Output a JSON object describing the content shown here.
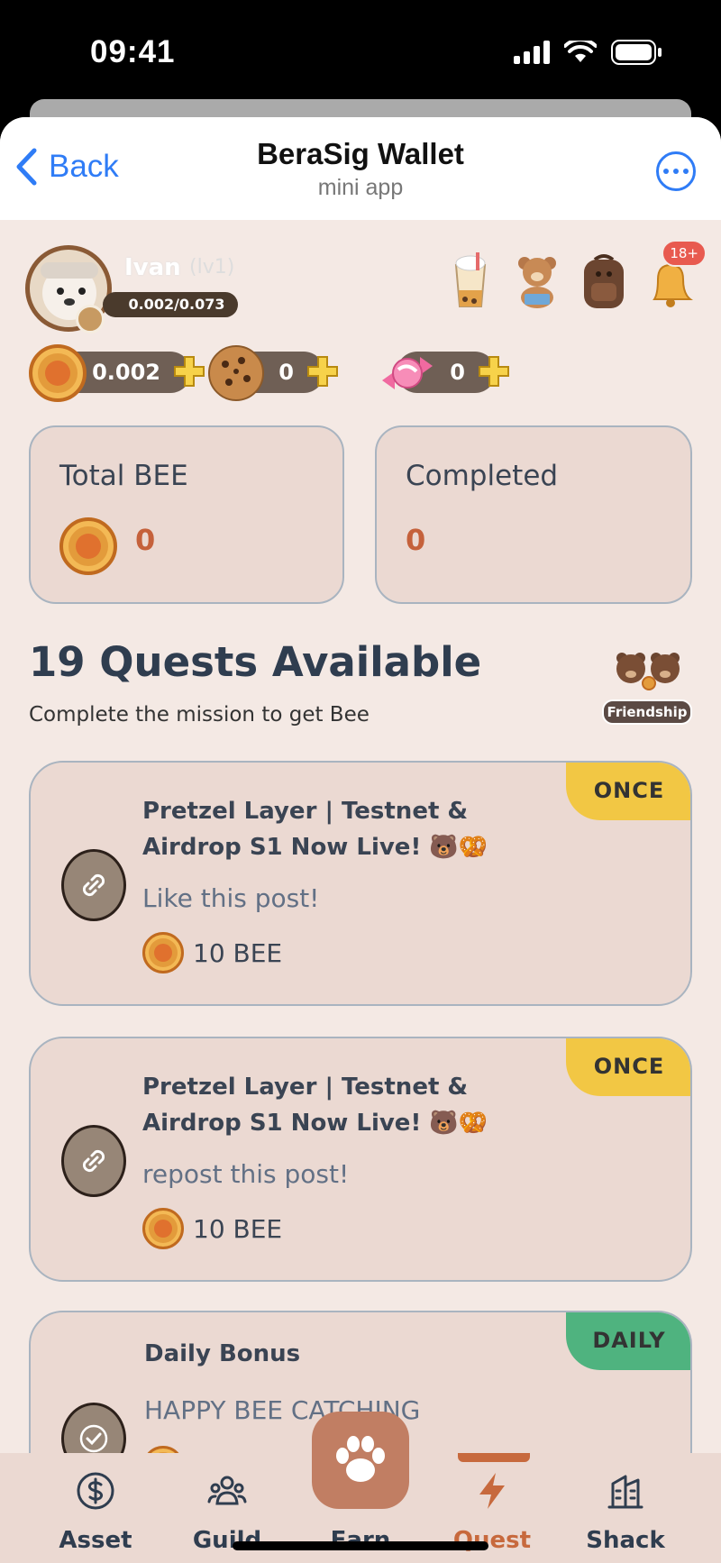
{
  "status_bar": {
    "time": "09:41"
  },
  "header": {
    "back_label": "Back",
    "title": "BeraSig Wallet",
    "subtitle": "mini app"
  },
  "profile": {
    "name": "Ivan",
    "level": "lv1",
    "xp": "0.002/0.073"
  },
  "inventory": {
    "notification_badge": "18+"
  },
  "currencies": [
    {
      "name": "bee-coin",
      "value": "0.002"
    },
    {
      "name": "cookie",
      "value": "0"
    },
    {
      "name": "candy",
      "value": "0"
    }
  ],
  "stats": {
    "total_label": "Total BEE",
    "total_value": "0",
    "completed_label": "Completed",
    "completed_value": "0"
  },
  "quests": {
    "title": "19 Quests Available",
    "subtitle": "Complete the mission to get Bee",
    "friendship_label": "Friendship",
    "items": [
      {
        "frequency": "ONCE",
        "title": "Pretzel Layer | Testnet & Airdrop S1 Now Live! 🐻🥨",
        "description": "Like this post!",
        "reward": "10 BEE"
      },
      {
        "frequency": "ONCE",
        "title": "Pretzel Layer | Testnet & Airdrop S1 Now Live! 🐻🥨",
        "description": "repost this post!",
        "reward": "10 BEE"
      },
      {
        "frequency": "DAILY",
        "title": "Daily Bonus",
        "description": "HAPPY BEE CATCHING",
        "reward": ""
      }
    ]
  },
  "nav": {
    "items": [
      {
        "label": "Asset"
      },
      {
        "label": "Guild"
      },
      {
        "label": "Earn"
      },
      {
        "label": "Quest"
      },
      {
        "label": "Shack"
      }
    ],
    "active": "Quest"
  },
  "colors": {
    "accent": "#c7693d",
    "once_tag": "#f2c744",
    "daily_tag": "#4fb37f",
    "ios_blue": "#2f7cf6"
  }
}
